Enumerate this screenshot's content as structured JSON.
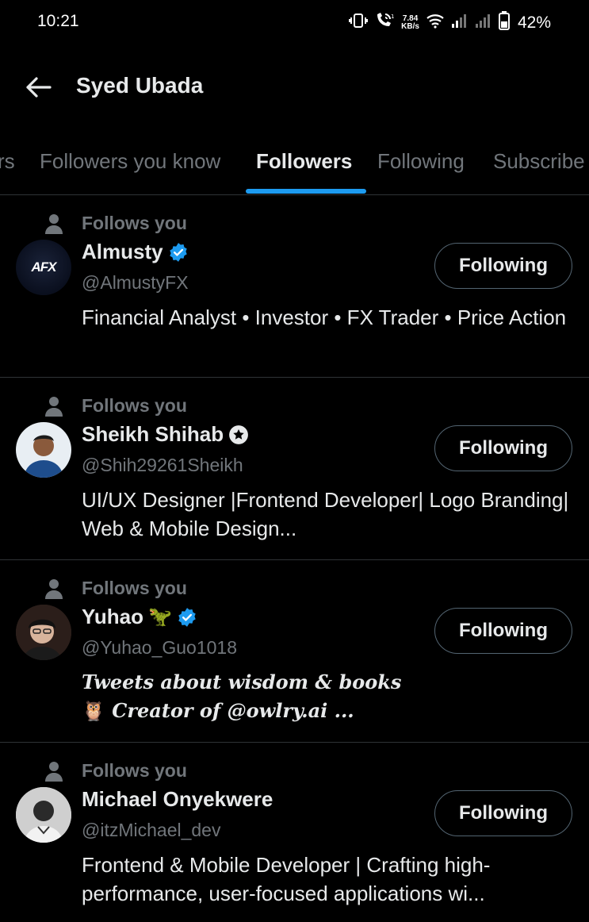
{
  "status_bar": {
    "time": "10:21",
    "speed_value": "7.84",
    "speed_unit": "KB/s",
    "battery_percent": "42%"
  },
  "header": {
    "title": "Syed Ubada"
  },
  "tabs": [
    {
      "label": "rs"
    },
    {
      "label": "Followers you know"
    },
    {
      "label": "Followers",
      "active": true
    },
    {
      "label": "Following"
    },
    {
      "label": "Subscribe"
    }
  ],
  "colors": {
    "accent": "#1d9bf0",
    "background": "#000000",
    "muted": "#71767b",
    "border": "#2f3336"
  },
  "users": [
    {
      "follows_label": "Follows you",
      "name": "Almusty",
      "badge": "verified-badge-icon",
      "handle": "@AlmustyFX",
      "bio": "Financial Analyst • Investor • FX Trader • Price Action",
      "avatar_text": "AFX",
      "button_label": "Following"
    },
    {
      "follows_label": "Follows you",
      "name": "Sheikh Shihab",
      "badge": "star-badge-icon",
      "handle": "@Shih29261Sheikh",
      "bio": "UI/UX Designer |Frontend Developer| Logo Branding| Web & Mobile Design...",
      "button_label": "Following"
    },
    {
      "follows_label": "Follows you",
      "name": "Yuhao",
      "name_emoji": "🦖",
      "badge": "verified-badge-icon",
      "handle": "@Yuhao_Guo1018",
      "bio_line1": "Tweets about wisdom & books",
      "bio_line2_emoji": "🦉",
      "bio_line2": " Creator of @owlry.ai ...",
      "button_label": "Following"
    },
    {
      "follows_label": "Follows you",
      "name": "Michael Onyekwere",
      "handle": "@itzMichael_dev",
      "bio": "Frontend & Mobile Developer | Crafting high-performance, user-focused applications wi...",
      "button_label": "Following"
    }
  ]
}
